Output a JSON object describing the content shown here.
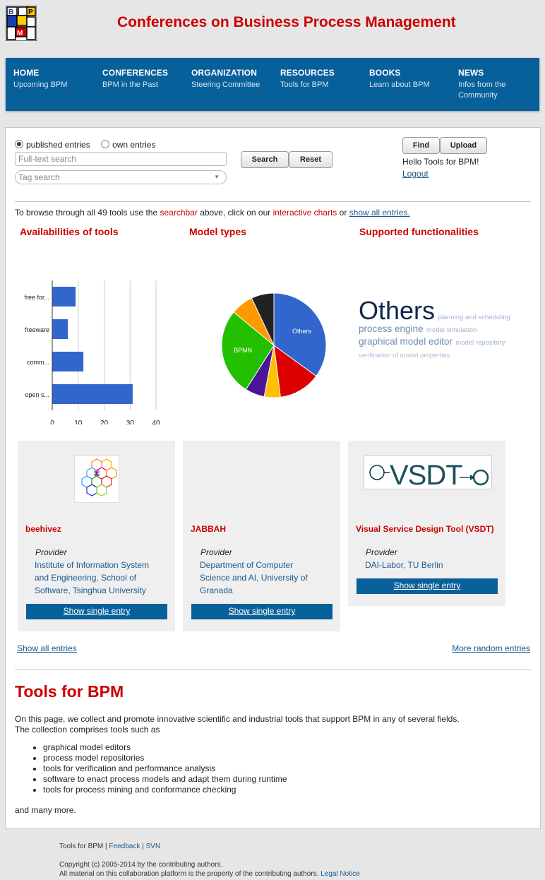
{
  "site": {
    "title": "Conferences on Business Process Management",
    "logo_letters": [
      "B",
      "P",
      "M"
    ]
  },
  "nav": [
    {
      "title": "HOME",
      "sub": "Upcoming BPM"
    },
    {
      "title": "CONFERENCES",
      "sub": "BPM in the Past"
    },
    {
      "title": "ORGANIZATION",
      "sub": "Steering Committee"
    },
    {
      "title": "RESOURCES",
      "sub": "Tools for BPM"
    },
    {
      "title": "BOOKS",
      "sub": "Learn about BPM"
    },
    {
      "title": "NEWS",
      "sub": "Infos from the Community"
    }
  ],
  "search": {
    "radio_published": "published entries",
    "radio_own": "own entries",
    "fulltext_placeholder": "Full-text search",
    "tag_placeholder": "Tag search",
    "search_label": "Search",
    "reset_label": "Reset"
  },
  "user": {
    "find_label": "Find",
    "upload_label": "Upload",
    "greeting": "Hello Tools for BPM!",
    "logout": "Logout"
  },
  "browse": {
    "prefix": "To browse through all 49 tools use the",
    "searchbar": "searchbar",
    "middle": "above, click on our",
    "charts": "interactive charts",
    "or": "or",
    "show_all": "show all entries."
  },
  "sections": {
    "availability": "Availabilities of tools",
    "model_types": "Model types",
    "functionalities": "Supported functionalities"
  },
  "chart_data": [
    {
      "type": "bar",
      "orientation": "horizontal",
      "title": "Availabilities of tools",
      "categories": [
        "free for...",
        "freeware",
        "comm...",
        "open s..."
      ],
      "values": [
        9,
        6,
        12,
        31
      ],
      "xlim": [
        0,
        40
      ],
      "xticks": [
        "0",
        "10",
        "20",
        "30",
        "40"
      ],
      "color": "#3366cc",
      "grid": true
    },
    {
      "type": "pie",
      "title": "Model types",
      "slices": [
        {
          "label": "Others",
          "value": 35,
          "color": "#3366cc"
        },
        {
          "label": "",
          "value": 13,
          "color": "#dc0000"
        },
        {
          "label": "",
          "value": 5,
          "color": "#ffc000"
        },
        {
          "label": "",
          "value": 6,
          "color": "#4c1499"
        },
        {
          "label": "BPMN",
          "value": 27,
          "color": "#22c000"
        },
        {
          "label": "",
          "value": 7,
          "color": "#ff9900"
        },
        {
          "label": "",
          "value": 7,
          "color": "#222222"
        }
      ]
    }
  ],
  "tag_cloud": [
    {
      "text": "Others",
      "size": 36,
      "color": "#10284a"
    },
    {
      "text": "planning and scheduling",
      "size": 9,
      "color": "#9fb4cc"
    },
    {
      "text": "process engine",
      "size": 13,
      "color": "#6e8db0"
    },
    {
      "text": "model simulation",
      "size": 9,
      "color": "#9fb4cc"
    },
    {
      "text": "graphical model editor",
      "size": 13,
      "color": "#6e8db0"
    },
    {
      "text": "model repository",
      "size": 9,
      "color": "#9fb4cc"
    },
    {
      "text": "verification of model properties",
      "size": 9,
      "color": "#a8bcd2"
    }
  ],
  "cards": [
    {
      "name": "beehivez",
      "provider_label": "Provider",
      "provider": "Institute of Information System and Engineering, School of Software, Tsinghua University",
      "button": "Show single entry"
    },
    {
      "name": "JABBAH",
      "provider_label": "Provider",
      "provider": "Department of Computer Science and AI, University of Granada",
      "button": "Show single entry"
    },
    {
      "name": "Visual Service Design Tool (VSDT)",
      "provider_label": "Provider",
      "provider": "DAI-Labor, TU Berlin",
      "button": "Show single entry",
      "logo_text": "VSDT"
    }
  ],
  "links": {
    "show_all": "Show all entries",
    "more_random": "More random entries"
  },
  "intro": {
    "title": "Tools for BPM",
    "line1": "On this page, we collect and promote innovative scientific and industrial tools that support BPM in any of several fields.",
    "line2": "The collection comprises tools such as",
    "items": [
      "graphical model editors",
      "process model repositories",
      "tools for verification and performance analysis",
      "software to enact process models and adapt them during runtime",
      "tools for process mining and conformance checking"
    ],
    "closing": "and many more."
  },
  "footer": {
    "site": "Tools for BPM",
    "sep": "|",
    "feedback": "Feedback",
    "svn": "SVN",
    "copyright": "Copyright (c) 2005-2014 by the contributing authors.",
    "property": "All material on this collaboration platform is the property of the contributing authors.",
    "legal": "Legal Notice"
  }
}
